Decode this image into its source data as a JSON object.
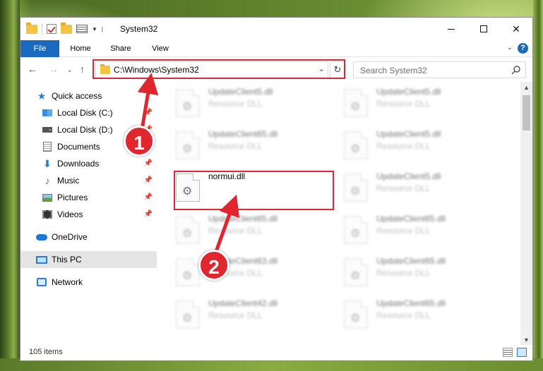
{
  "window": {
    "title": "System32",
    "controls": {
      "minimize": "–",
      "maximize": "☐",
      "close": "✕"
    }
  },
  "ribbon": {
    "tabs": [
      "File",
      "Home",
      "Share",
      "View"
    ],
    "expand": "⌄",
    "help": "?"
  },
  "nav": {
    "back": "←",
    "forward": "→",
    "recent": "⌄",
    "up": "↑",
    "address": "C:\\Windows\\System32",
    "address_dropdown": "⌄",
    "refresh": "↻",
    "search_placeholder": "Search System32"
  },
  "sidebar": {
    "items": [
      {
        "label": "Quick access",
        "icon": "star-icon",
        "pinned": false
      },
      {
        "label": "Local Disk (C:)",
        "icon": "drive-icon",
        "pinned": true
      },
      {
        "label": "Local Disk (D:)",
        "icon": "drive-icon",
        "pinned": true
      },
      {
        "label": "Documents",
        "icon": "documents-icon",
        "pinned": true
      },
      {
        "label": "Downloads",
        "icon": "download-icon",
        "pinned": true
      },
      {
        "label": "Music",
        "icon": "music-icon",
        "pinned": true
      },
      {
        "label": "Pictures",
        "icon": "pictures-icon",
        "pinned": true
      },
      {
        "label": "Videos",
        "icon": "videos-icon",
        "pinned": true
      },
      {
        "label": "OneDrive",
        "icon": "cloud-icon",
        "pinned": false
      },
      {
        "label": "This PC",
        "icon": "pc-icon",
        "pinned": false,
        "selected": true
      },
      {
        "label": "Network",
        "icon": "network-icon",
        "pinned": false
      }
    ]
  },
  "files": {
    "left": [
      {
        "name": "UpdateClient5.dll",
        "type": "Resource DLL"
      },
      {
        "name": "UpdateClient65.dll",
        "type": "Resource DLL"
      },
      {
        "name": "normui.dll",
        "type": ""
      },
      {
        "name": "UpdateClient65.dll",
        "type": "Resource DLL"
      },
      {
        "name": "UpdateClient63.dll",
        "type": "Resource DLL"
      },
      {
        "name": "UpdateClient42.dll",
        "type": "Resource DLL"
      }
    ],
    "right": [
      {
        "name": "UpdateClient5.dll",
        "type": "Resource DLL"
      },
      {
        "name": "UpdateClient5.dll",
        "type": "Resource DLL"
      },
      {
        "name": "UpdateClient5.dll",
        "type": "Resource DLL"
      },
      {
        "name": "UpdateClient65.dll",
        "type": "Resource DLL"
      },
      {
        "name": "UpdateClient65.dll",
        "type": "Resource DLL"
      },
      {
        "name": "UpdateClient65.dll",
        "type": "Resource DLL"
      }
    ]
  },
  "status": {
    "item_count": "105 items"
  },
  "annotations": {
    "step1": "1",
    "step2": "2",
    "color": "#e0262e"
  },
  "colors": {
    "accent": "#1a6ac2",
    "highlight": "#e0262e"
  }
}
